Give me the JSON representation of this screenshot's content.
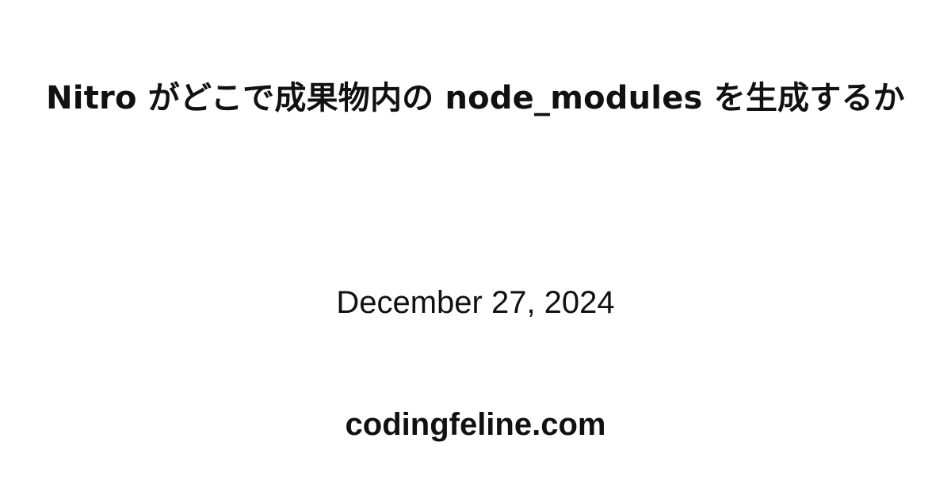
{
  "post": {
    "title": "Nitro がどこで成果物内の node_modules を生成するか",
    "date": "December 27, 2024",
    "site": "codingfeline.com"
  }
}
